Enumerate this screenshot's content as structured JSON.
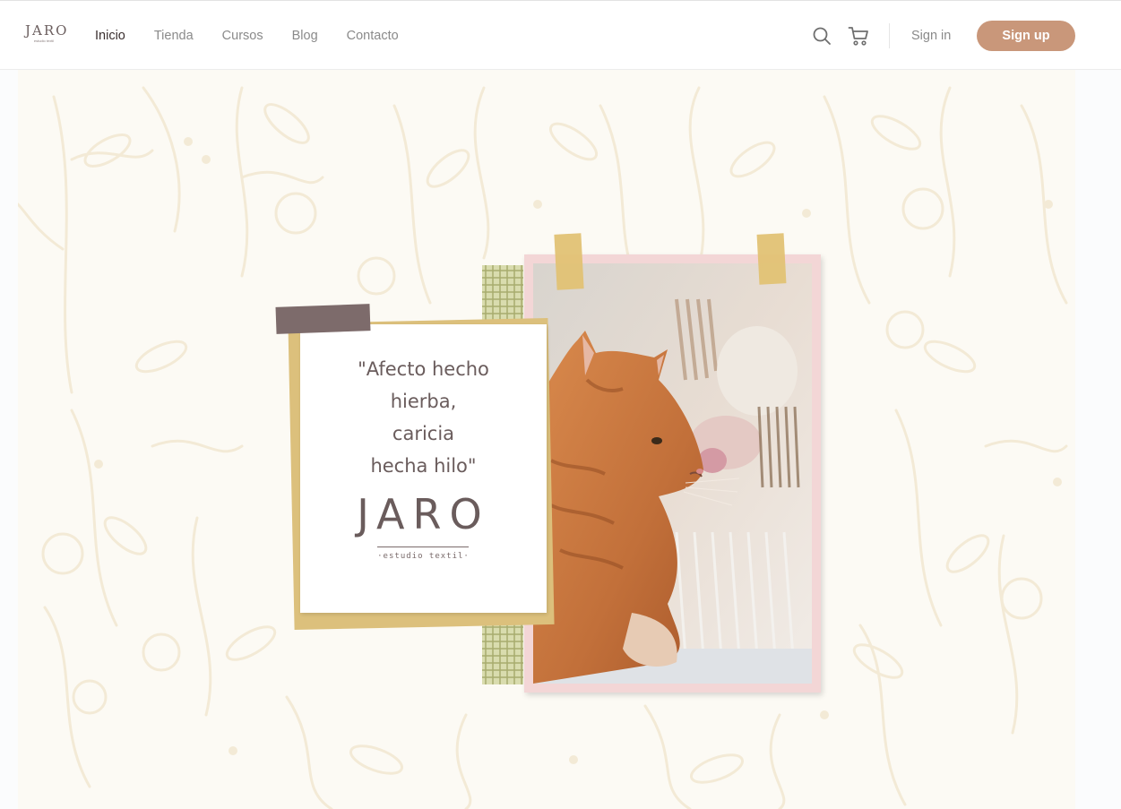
{
  "brand": {
    "name": "JARO",
    "tagline": "estudio textil"
  },
  "nav": {
    "items": [
      {
        "label": "Inicio",
        "active": true
      },
      {
        "label": "Tienda",
        "active": false
      },
      {
        "label": "Cursos",
        "active": false
      },
      {
        "label": "Blog",
        "active": false
      },
      {
        "label": "Contacto",
        "active": false
      }
    ]
  },
  "header": {
    "search_icon": "search-icon",
    "cart_icon": "cart-icon",
    "sign_in_label": "Sign in",
    "sign_up_label": "Sign up"
  },
  "hero": {
    "quote_lines": [
      "\"Afecto hecho",
      "hierba,",
      "caricia",
      "hecha hilo\""
    ],
    "brand_mark": "JARO",
    "brand_subtitle": "·estudio textil·"
  },
  "colors": {
    "accent": "#c9977a",
    "nav_active": "#3a2f2f",
    "nav_inactive": "#8a8a8a",
    "pattern": "#f3ead6",
    "note_tape": "#7d6b6b",
    "yellow_tape": "#e2c274",
    "photo_frame": "#f3d6d6"
  }
}
